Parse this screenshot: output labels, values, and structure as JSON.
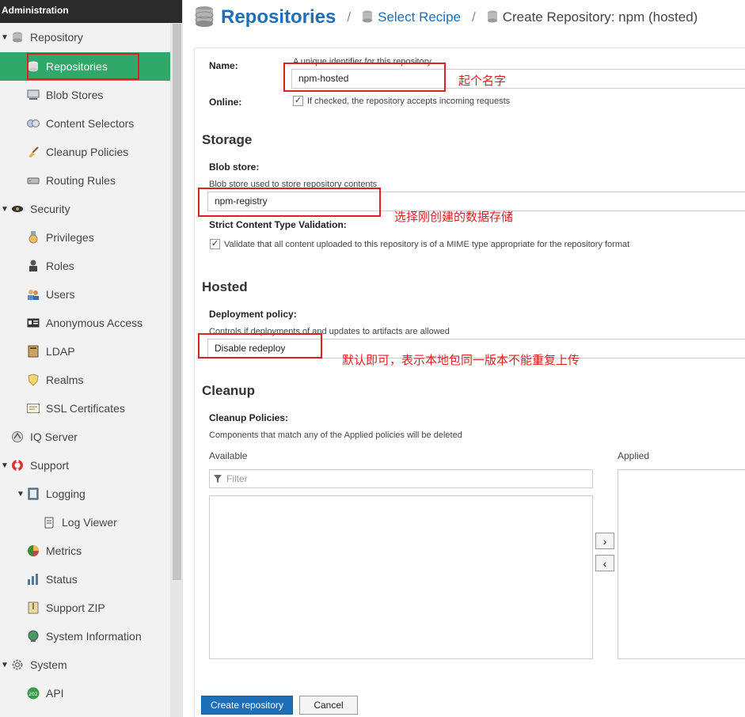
{
  "sidebar": {
    "header": "Administration",
    "items": [
      {
        "label": "Repository",
        "icon": "database-icon"
      },
      {
        "label": "Repositories",
        "icon": "database-icon"
      },
      {
        "label": "Blob Stores",
        "icon": "server-icon"
      },
      {
        "label": "Content Selectors",
        "icon": "selector-icon"
      },
      {
        "label": "Cleanup Policies",
        "icon": "broom-icon"
      },
      {
        "label": "Routing Rules",
        "icon": "router-icon"
      },
      {
        "label": "Security",
        "icon": "spy-icon"
      },
      {
        "label": "Privileges",
        "icon": "medal-icon"
      },
      {
        "label": "Roles",
        "icon": "role-icon"
      },
      {
        "label": "Users",
        "icon": "users-icon"
      },
      {
        "label": "Anonymous Access",
        "icon": "id-card-icon"
      },
      {
        "label": "LDAP",
        "icon": "book-icon"
      },
      {
        "label": "Realms",
        "icon": "shield-icon"
      },
      {
        "label": "SSL Certificates",
        "icon": "certificate-icon"
      },
      {
        "label": "IQ Server",
        "icon": "iq-server-icon"
      },
      {
        "label": "Support",
        "icon": "lifebuoy-icon"
      },
      {
        "label": "Logging",
        "icon": "log-book-icon"
      },
      {
        "label": "Log Viewer",
        "icon": "scroll-icon"
      },
      {
        "label": "Metrics",
        "icon": "pie-chart-icon"
      },
      {
        "label": "Status",
        "icon": "status-icon"
      },
      {
        "label": "Support ZIP",
        "icon": "zip-icon"
      },
      {
        "label": "System Information",
        "icon": "globe-icon"
      },
      {
        "label": "System",
        "icon": "gear-icon"
      },
      {
        "label": "API",
        "icon": "api-icon"
      }
    ]
  },
  "breadcrumb": {
    "title": "Repositories",
    "separator": "/",
    "link": "Select Recipe",
    "current": "Create Repository: npm (hosted)"
  },
  "form": {
    "name_label": "Name:",
    "name_help": "A unique identifier for this repository",
    "name_value": "npm-hosted",
    "online_label": "Online:",
    "online_help": "If checked, the repository accepts incoming requests",
    "storage_title": "Storage",
    "blob_label": "Blob store:",
    "blob_help": "Blob store used to store repository contents",
    "blob_value": "npm-registry",
    "strict_label": "Strict Content Type Validation:",
    "strict_help": "Validate that all content uploaded to this repository is of a MIME type appropriate for the repository format",
    "hosted_title": "Hosted",
    "deploy_label": "Deployment policy:",
    "deploy_help": "Controls if deployments of and updates to artifacts are allowed",
    "deploy_value": "Disable redeploy",
    "cleanup_title": "Cleanup",
    "cleanup_label": "Cleanup Policies:",
    "cleanup_help": "Components that match any of the Applied policies will be deleted",
    "available_label": "Available",
    "applied_label": "Applied",
    "filter_placeholder": "Filter",
    "move_right": "›",
    "move_left": "‹",
    "create_button": "Create repository",
    "cancel_button": "Cancel"
  },
  "annotations": {
    "name_note": "起个名字",
    "blob_note": "选择刚创建的数据存储",
    "deploy_note": "默认即可，表示本地包同一版本不能重复上传"
  },
  "colors": {
    "active_item": "#2fa86a",
    "primary": "#1d6fb8",
    "annotation": "#e02020"
  }
}
